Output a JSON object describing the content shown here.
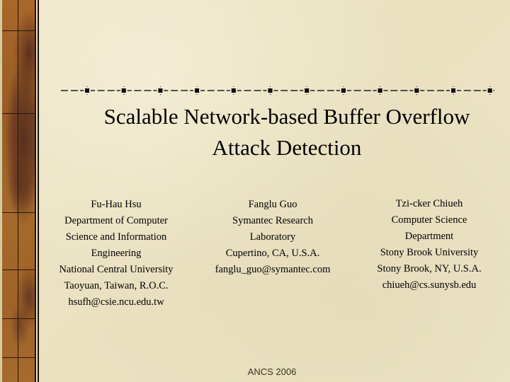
{
  "slide": {
    "title_lines": [
      "Scalable Network-based Buffer Overflow",
      "Attack Detection"
    ],
    "authors": [
      {
        "lines": [
          "Fu-Hau Hsu",
          "Department of Computer",
          "Science and Information",
          "Engineering",
          "National Central University",
          "Taoyuan, Taiwan, R.O.C.",
          "hsufh@csie.ncu.edu.tw"
        ]
      },
      {
        "lines": [
          "Fanglu Guo",
          "Symantec Research",
          "Laboratory",
          "Cupertino, CA, U.S.A.",
          "fanglu_guo@symantec.com"
        ]
      },
      {
        "lines": [
          "Tzi-cker Chiueh",
          "Computer Science",
          "Department",
          "Stony Brook University",
          "Stony Brook, NY, U.S.A.",
          "chiueh@cs.sunysb.edu"
        ]
      }
    ],
    "footer": "ANCS 2006"
  },
  "theme": {
    "background": "#ebe4c5",
    "band_color": "#a0622a",
    "band_dark": "#55301e",
    "text_color": "#000000",
    "footer_color": "#3a3220"
  },
  "decorations": {
    "left_band": "textured-brown-panel",
    "divider": "dash-square-rule"
  }
}
